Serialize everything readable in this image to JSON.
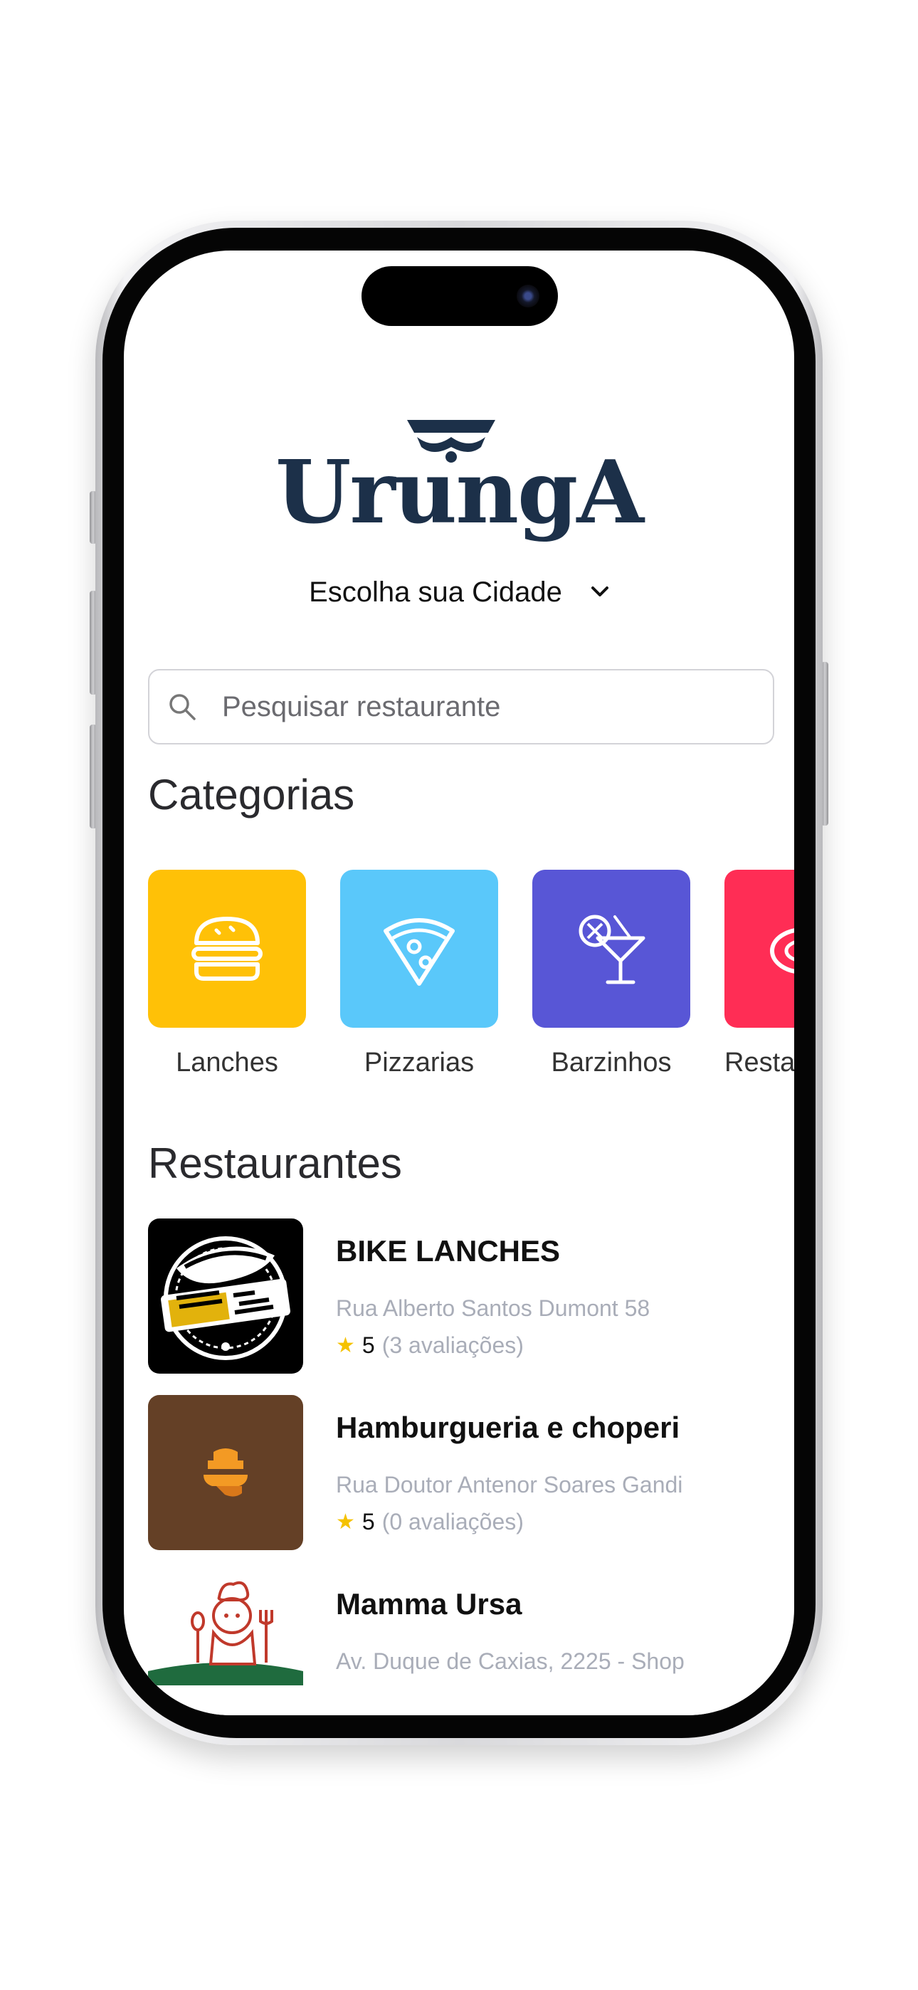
{
  "app": {
    "logo_text": "UrungA"
  },
  "city_select": {
    "label": "Escolha sua Cidade"
  },
  "search": {
    "placeholder": "Pesquisar restaurante"
  },
  "categories": {
    "title": "Categorias",
    "items": [
      {
        "label": "Lanches",
        "icon": "burger-icon",
        "color": "#ffc107"
      },
      {
        "label": "Pizzarias",
        "icon": "pizza-icon",
        "color": "#5ac8fa"
      },
      {
        "label": "Barzinhos",
        "icon": "cocktail-icon",
        "color": "#5856d6"
      },
      {
        "label": "Resta",
        "icon": "dish-icon",
        "color": "#ff2d55"
      }
    ]
  },
  "restaurants": {
    "title": "Restaurantes",
    "items": [
      {
        "name": "BIKE LANCHES",
        "address": "Rua Alberto Santos Dumont 58",
        "rating": "5",
        "reviews": "(3 avaliações)"
      },
      {
        "name": "Hamburgueria e choperi",
        "address": "Rua Doutor Antenor Soares Gandi",
        "rating": "5",
        "reviews": "(0 avaliações)"
      },
      {
        "name": "Mamma Ursa",
        "address": "Av. Duque de Caxias, 2225 - Shop",
        "rating": "",
        "reviews": ""
      }
    ]
  },
  "colors": {
    "brand": "#1c3049",
    "star": "#f5c200"
  }
}
